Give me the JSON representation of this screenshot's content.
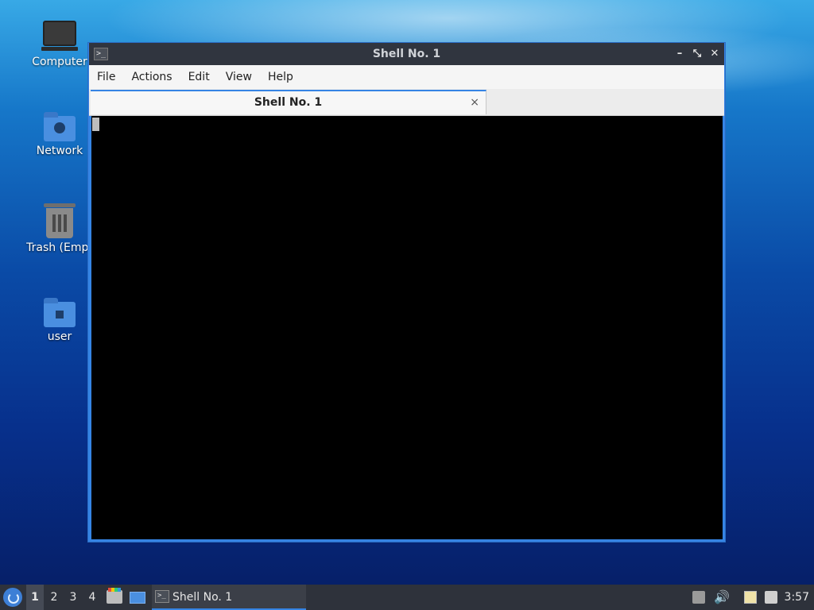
{
  "desktop": {
    "icons": [
      {
        "label": "Computer",
        "icon": "computer-icon"
      },
      {
        "label": "Network",
        "icon": "network-folder-icon"
      },
      {
        "label": "Trash (Empt",
        "icon": "trash-icon"
      },
      {
        "label": "user",
        "icon": "home-folder-icon"
      }
    ]
  },
  "window": {
    "title": "Shell No. 1",
    "menu": [
      "File",
      "Actions",
      "Edit",
      "View",
      "Help"
    ],
    "tabs": [
      {
        "label": "Shell No. 1",
        "close_glyph": "×"
      }
    ],
    "controls": {
      "minimize": "–",
      "restore": "⤡",
      "close": "✕"
    },
    "icon_glyph": ">_"
  },
  "taskbar": {
    "workspaces": [
      "1",
      "2",
      "3",
      "4"
    ],
    "active_workspace": "1",
    "tasks": [
      {
        "label": "Shell No. 1",
        "icon_glyph": ">_"
      }
    ],
    "clock": "3:57",
    "speaker_glyph": "🔊"
  }
}
